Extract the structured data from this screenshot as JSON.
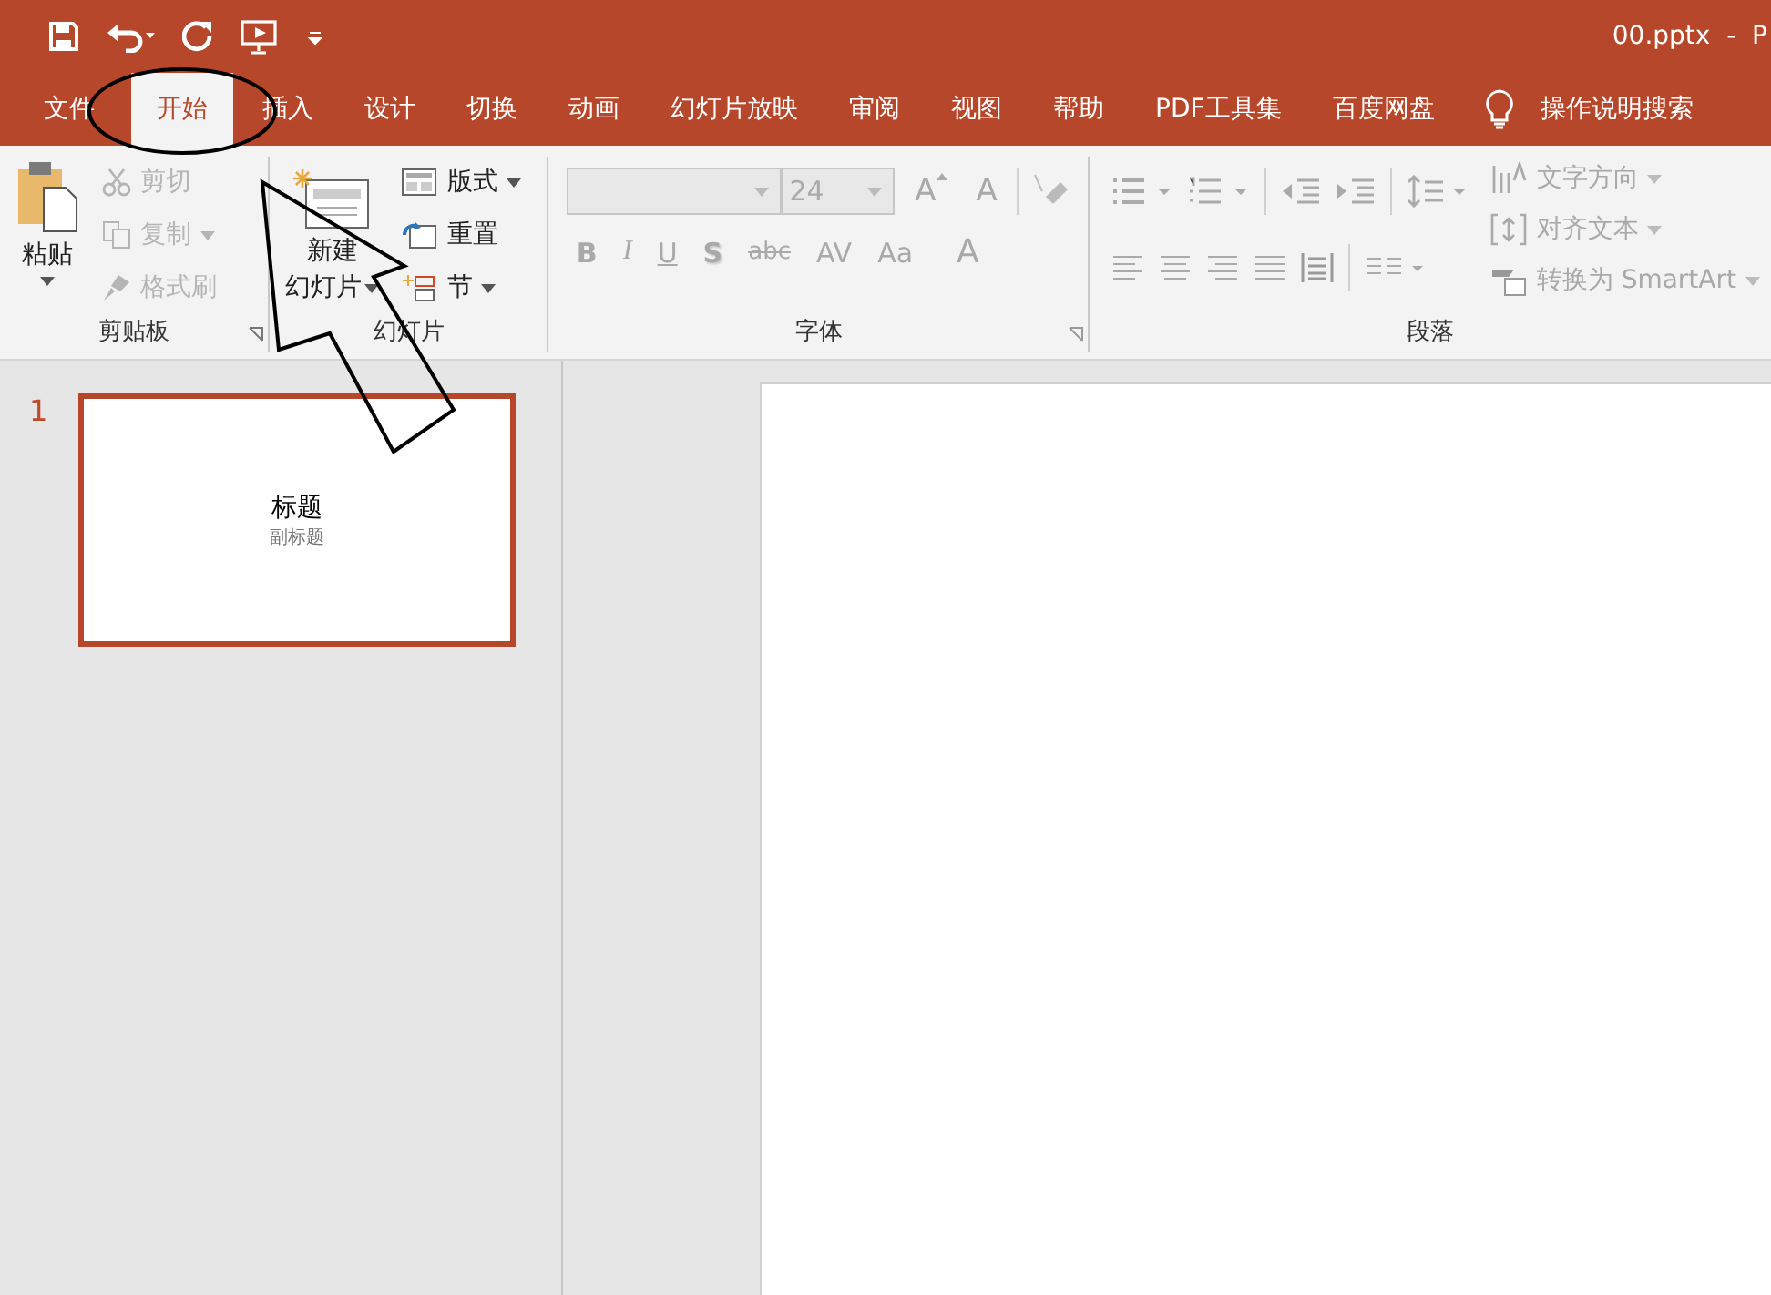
{
  "window": {
    "title": "00.pptx  -  P"
  },
  "tabs": [
    {
      "label": "文件",
      "selected": false
    },
    {
      "label": "开始",
      "selected": true
    },
    {
      "label": "插入",
      "selected": false
    },
    {
      "label": "设计",
      "selected": false
    },
    {
      "label": "切换",
      "selected": false
    },
    {
      "label": "动画",
      "selected": false
    },
    {
      "label": "幻灯片放映",
      "selected": false
    },
    {
      "label": "审阅",
      "selected": false
    },
    {
      "label": "视图",
      "selected": false
    },
    {
      "label": "帮助",
      "selected": false
    },
    {
      "label": "PDF工具集",
      "selected": false
    },
    {
      "label": "百度网盘",
      "selected": false
    }
  ],
  "search": {
    "label": "操作说明搜索"
  },
  "clipboard": {
    "label": "剪贴板",
    "paste": {
      "label": "粘贴",
      "disabled": false
    },
    "items": [
      {
        "kind": "cut",
        "label": "剪切",
        "disabled": true,
        "dropdown": false
      },
      {
        "kind": "copy",
        "label": "复制",
        "disabled": true,
        "dropdown": true
      },
      {
        "kind": "brush",
        "label": "格式刷",
        "disabled": true,
        "dropdown": false
      }
    ]
  },
  "slides_group": {
    "label": "幻灯片",
    "new_slide": {
      "lines": [
        "新建",
        "幻灯片"
      ]
    },
    "items": [
      {
        "kind": "layout",
        "label": "版式",
        "disabled": false
      },
      {
        "kind": "reset",
        "label": "重置",
        "disabled": false
      },
      {
        "kind": "section",
        "label": "节",
        "disabled": false
      }
    ]
  },
  "font": {
    "label": "字体",
    "size": {
      "value": "24"
    },
    "disabled": true,
    "grow": "A",
    "shrink": "A",
    "format_buttons": [
      {
        "label": "B",
        "kind": "bold"
      },
      {
        "label": "I",
        "kind": "italic"
      },
      {
        "label": "U",
        "kind": "underline"
      },
      {
        "label": "S",
        "kind": "shadow"
      },
      {
        "label": "abc",
        "kind": "strike"
      },
      {
        "label": "AV",
        "kind": "spacing"
      },
      {
        "label": "Aa",
        "kind": "case"
      },
      {
        "label": "A",
        "kind": "color"
      }
    ]
  },
  "paragraph": {
    "label": "段落",
    "disabled": true,
    "items": [
      {
        "kind": "direction",
        "label": "文字方向"
      },
      {
        "kind": "align",
        "label": "对齐文本"
      },
      {
        "kind": "smartart",
        "label": "转换为 SmartArt"
      }
    ]
  },
  "thumbnails": [
    {
      "number": "1",
      "selected": true,
      "title": "标题",
      "subtitle": "副标题"
    }
  ]
}
